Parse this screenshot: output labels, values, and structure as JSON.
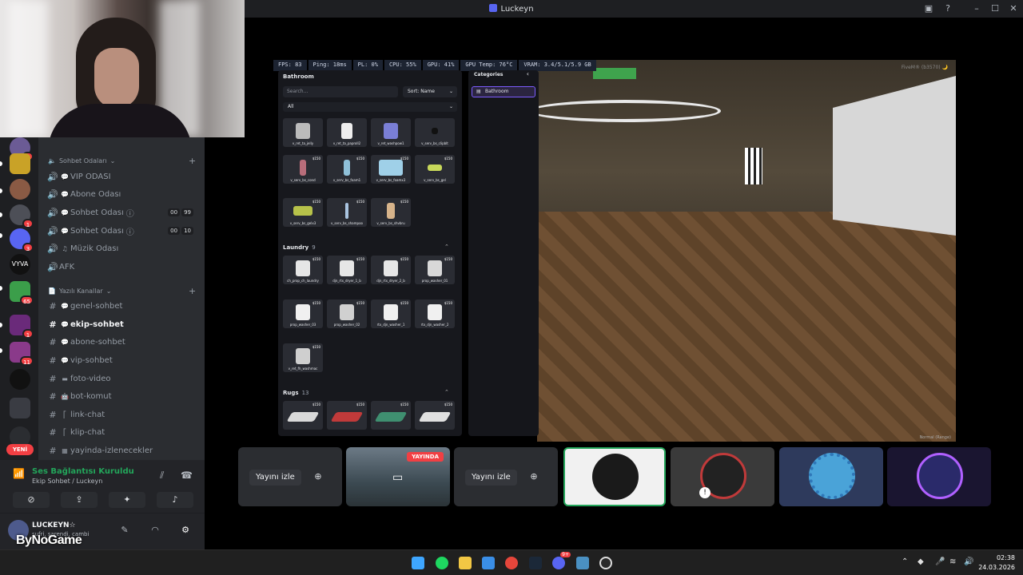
{
  "window": {
    "title": "Luckeyn"
  },
  "servers": {
    "badges": [
      "2",
      "1",
      "3",
      "65",
      "1",
      "11"
    ],
    "new_label": "YENİ"
  },
  "channels": {
    "voice_category": "Sohbet Odaları",
    "voice_channels": [
      {
        "name": "VIP ODASI"
      },
      {
        "name": "Abone Odası"
      },
      {
        "name": "Sohbet Odası",
        "count_a": "00",
        "count_b": "99"
      },
      {
        "name": "Sohbet Odası",
        "count_a": "00",
        "count_b": "10"
      },
      {
        "name": "Müzik Odası"
      },
      {
        "name": "AFK"
      }
    ],
    "text_category": "Yazılı Kanallar",
    "text_channels": [
      {
        "name": "genel-sohbet"
      },
      {
        "name": "ekip-sohbet",
        "active": true
      },
      {
        "name": "abone-sohbet"
      },
      {
        "name": "vip-sohbet"
      },
      {
        "name": "foto-video"
      },
      {
        "name": "bot-komut"
      },
      {
        "name": "link-chat"
      },
      {
        "name": "klip-chat"
      },
      {
        "name": "yayinda-izlenecekler"
      }
    ]
  },
  "voice_panel": {
    "status": "Ses Bağlantısı Kuruldu",
    "location": "Ekip Sohbet / Luckeyn"
  },
  "user_panel": {
    "name": "LUCKEYN☆",
    "status": "sufri, sarendi, cambi",
    "brand": "ByNoGame"
  },
  "game": {
    "stats": [
      "FPS: 83",
      "Ping: 18ms",
      "PL: 0%",
      "CPU: 55%",
      "GPU: 41%",
      "GPU Temp: 76°C",
      "VRAM: 3.4/5.1/5.9 GB"
    ],
    "watermark": "FiveM® (b3570) 🌙",
    "hud_bottom": "Normal (Range)",
    "panel": {
      "section_title": "Bathroom",
      "search_placeholder": "Search...",
      "sort_label": "Sort: Name",
      "filter_label": "All",
      "bathroom_items": [
        {
          "name": "v_ret_ta_jelly",
          "price": ""
        },
        {
          "name": "v_ret_ta_paproll2",
          "price": ""
        },
        {
          "name": "v_ret_washpow1",
          "price": ""
        },
        {
          "name": "v_serv_bs_clipblt",
          "price": ""
        },
        {
          "name": "v_serv_bs_cond",
          "price": "$150"
        },
        {
          "name": "v_serv_bs_foam1",
          "price": "$150"
        },
        {
          "name": "v_serv_bs_foamx3",
          "price": "$150"
        },
        {
          "name": "v_serv_bs_gel",
          "price": "$150"
        },
        {
          "name": "v_serv_bs_gelx3",
          "price": "$150"
        },
        {
          "name": "v_serv_bs_shampoo",
          "price": "$150"
        },
        {
          "name": "v_serv_bs_shvbru",
          "price": "$150"
        }
      ],
      "laundry_title": "Laundry",
      "laundry_count": "9",
      "laundry_items": [
        {
          "name": "ch_prop_ch_laundry",
          "price": "$150"
        },
        {
          "name": "djn_rtx_dryer_1_b",
          "price": "$150"
        },
        {
          "name": "djn_rtx_dryer_2_b",
          "price": "$150"
        },
        {
          "name": "prop_washer_01",
          "price": "$150"
        },
        {
          "name": "prop_washer_03",
          "price": "$150"
        },
        {
          "name": "prop_washer_02",
          "price": "$150"
        },
        {
          "name": "rtx_djn_washer_1",
          "price": "$150"
        },
        {
          "name": "rtx_djn_washer_2",
          "price": "$150"
        },
        {
          "name": "v_ret_fh_washmac",
          "price": "$150"
        }
      ],
      "rugs_title": "Rugs",
      "rugs_count": "13",
      "rug_prices": [
        "$150",
        "$150",
        "$150",
        "$150"
      ]
    },
    "categories": {
      "title": "Categories",
      "selected": "Bathroom"
    }
  },
  "participants": {
    "watch_label": "Yayını izle",
    "live_label": "YAYINDA"
  },
  "taskbar": {
    "notif_badge": "9+",
    "time": "02:38",
    "date": "24.03.2026"
  }
}
